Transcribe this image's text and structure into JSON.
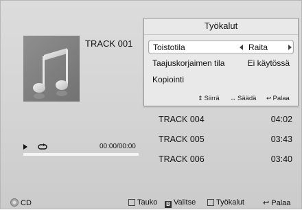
{
  "now_playing": {
    "track_title": "TRACK 001",
    "time": "00:00/00:00",
    "progress_fraction": 0
  },
  "icons": {
    "album": "music-note-icon",
    "play": "play-icon",
    "repeat": "repeat-icon"
  },
  "tools_menu": {
    "title": "Työkalut",
    "rows": [
      {
        "label": "Toistotila",
        "value": "Raita"
      },
      {
        "label": "Taajuskorjaimen tila",
        "value": "Ei käytössä"
      },
      {
        "label": "Kopiointi",
        "value": ""
      }
    ],
    "hints": {
      "move": "Siirrä",
      "adjust": "Säädä",
      "back": "Palaa"
    }
  },
  "tracklist": [
    {
      "name": "TRACK 004",
      "duration": "04:02"
    },
    {
      "name": "TRACK 005",
      "duration": "03:43"
    },
    {
      "name": "TRACK 006",
      "duration": "03:40"
    }
  ],
  "bottom_bar": {
    "source": "CD",
    "pause": "Tauko",
    "select": "Valitse",
    "tools": "Työkalut",
    "back": "Palaa",
    "select_key": "B"
  }
}
